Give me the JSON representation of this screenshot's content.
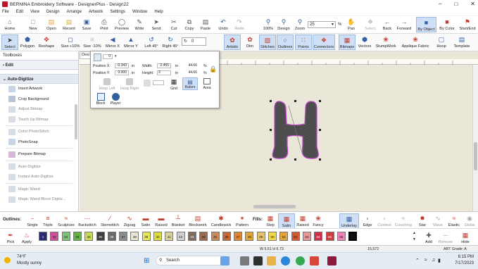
{
  "window": {
    "title": "BERNINA Embroidery Software - DesignerPlus - Design22",
    "minimize": "–",
    "maximize": "□",
    "close": "✕"
  },
  "menu": [
    "File",
    "Edit",
    "View",
    "Design",
    "Arrange",
    "Artwork",
    "Settings",
    "Window",
    "Help"
  ],
  "ribbon1": {
    "buttons": [
      "Home",
      "New",
      "Open",
      "Recent",
      "Save",
      "Print",
      "Preview",
      "Write",
      "Send",
      "Cut",
      "Copy",
      "Paste",
      "Undo",
      "Redo",
      "100%",
      "Design",
      "Zoom",
      "Pan",
      "Select",
      "Back",
      "Forward",
      "By Object",
      "By Color",
      "Start/End"
    ],
    "zoom_value": "25",
    "zoom_unit": "%"
  },
  "ribbon2": {
    "buttons": [
      "Select",
      "Polygon",
      "Reshape",
      "Size +10%",
      "Size -10%",
      "Mirror X",
      "Mirror Y",
      "Left 45°",
      "Right 45°",
      "Artistic",
      "Dim",
      "Stitches",
      "Outlines",
      "Points",
      "Connectors",
      "Bitmaps",
      "Vectors",
      "StumpWork",
      "Applique Fabric",
      "Hoop",
      "Template"
    ],
    "rotate_value": "0"
  },
  "leftpanel": {
    "title": "Toolboxes",
    "section_edit": "Edit",
    "section_auto": "Auto-Digitize",
    "items": [
      "Insert Artwork",
      "Crop Background",
      "Adjust Bitmap",
      "Touch Up Bitmap",
      "Color PhotoStitch",
      "PhotoSnap",
      "Prepare Bitmap",
      "Auto-Digitize",
      "Instant Auto-Digitize",
      "Magic Wand",
      "Magic Wand Block Digitiz..."
    ]
  },
  "doc_tab": "Desi",
  "popup": {
    "pos_x_label": "Position X:",
    "pos_x": "-0.343",
    "pos_x_unit": "in",
    "pos_y_label": "Position Y:",
    "pos_y": "0.000",
    "pos_y_unit": "in",
    "width_label": "Width:",
    "width": "2.455",
    "width_unit": "in",
    "width_pct": "44.66",
    "width_pct_unit": "%",
    "height_label": "Height:",
    "height": "3",
    "height_unit": "in",
    "height_pct": "44.66",
    "height_pct_unit": "%",
    "hoop_left": "Hoop Left",
    "hoop_right": "Hoop Right",
    "grid": "Grid",
    "rulers": "Rulers",
    "area": "Area",
    "block": "Block",
    "player": "Player",
    "small_field": "0"
  },
  "bottom": {
    "outlines_label": "Outlines:",
    "outlines": [
      "Single",
      "Triple",
      "Sculpture",
      "Backstitch",
      "Stemstitch",
      "Zigzag",
      "Satin",
      "Raised",
      "Blanket",
      "Blockwork",
      "Candlewick",
      "Pattern"
    ],
    "fills_label": "Fills:",
    "fills": [
      "Step",
      "Satin",
      "Raised",
      "Fancy"
    ],
    "right": [
      "Underlay",
      "Edge",
      "Contest",
      "Couching",
      "Star",
      "Wave",
      "Elastic",
      "Globe"
    ]
  },
  "colorbar": {
    "pick": "Pick",
    "apply": "Apply",
    "add": "Add",
    "remove": "Remove",
    "hide": "Hide",
    "swatches": [
      {
        "n": "1",
        "c": "#2a2a6e"
      },
      {
        "n": "31",
        "c": "#cf4f9d"
      },
      {
        "n": "32",
        "c": "#7fbf7a"
      },
      {
        "n": "33",
        "c": "#63b24a"
      },
      {
        "n": "34",
        "c": "#c6d858"
      },
      {
        "n": "35",
        "c": "#3e3e3e"
      },
      {
        "n": "36",
        "c": "#6b6b6b"
      },
      {
        "n": "37",
        "c": "#8c8c8c"
      },
      {
        "n": "38",
        "c": "#e9e3d1"
      },
      {
        "n": "39",
        "c": "#e4e45f"
      },
      {
        "n": "40",
        "c": "#dcdc3e"
      },
      {
        "n": "41",
        "c": "#d6d09a"
      },
      {
        "n": "42",
        "c": "#cfcfcf"
      },
      {
        "n": "43",
        "c": "#7d6b5d"
      },
      {
        "n": "44",
        "c": "#9b6a4f"
      },
      {
        "n": "45",
        "c": "#c58a58"
      },
      {
        "n": "46",
        "c": "#c36c3a"
      },
      {
        "n": "47",
        "c": "#e08637"
      },
      {
        "n": "48",
        "c": "#e0a53a"
      },
      {
        "n": "49",
        "c": "#e8c26a"
      },
      {
        "n": "50",
        "c": "#f0d84a"
      },
      {
        "n": "51",
        "c": "#e3a33a"
      },
      {
        "n": "52",
        "c": "#d75a2f"
      },
      {
        "n": "53",
        "c": "#e59a9a"
      },
      {
        "n": "54",
        "c": "#cf2f4a"
      },
      {
        "n": "55",
        "c": "#d23b3b"
      },
      {
        "n": "56",
        "c": "#ef80b5"
      },
      {
        "n": "",
        "c": "#111111"
      }
    ]
  },
  "status": {
    "dims": "W 5.51 H 6.73",
    "stitches": "15,572",
    "art_grade": "ART Grade: A"
  },
  "taskbar": {
    "temp": "74°F",
    "weather": "Mostly sunny",
    "search": "Search",
    "time": "6:15 PM",
    "date": "7/17/2023"
  },
  "colors": {
    "accent": "#cfe0f6",
    "canvas": "#eae6d8",
    "outline": "#b05ab5",
    "fill": "#4a4a4a"
  }
}
